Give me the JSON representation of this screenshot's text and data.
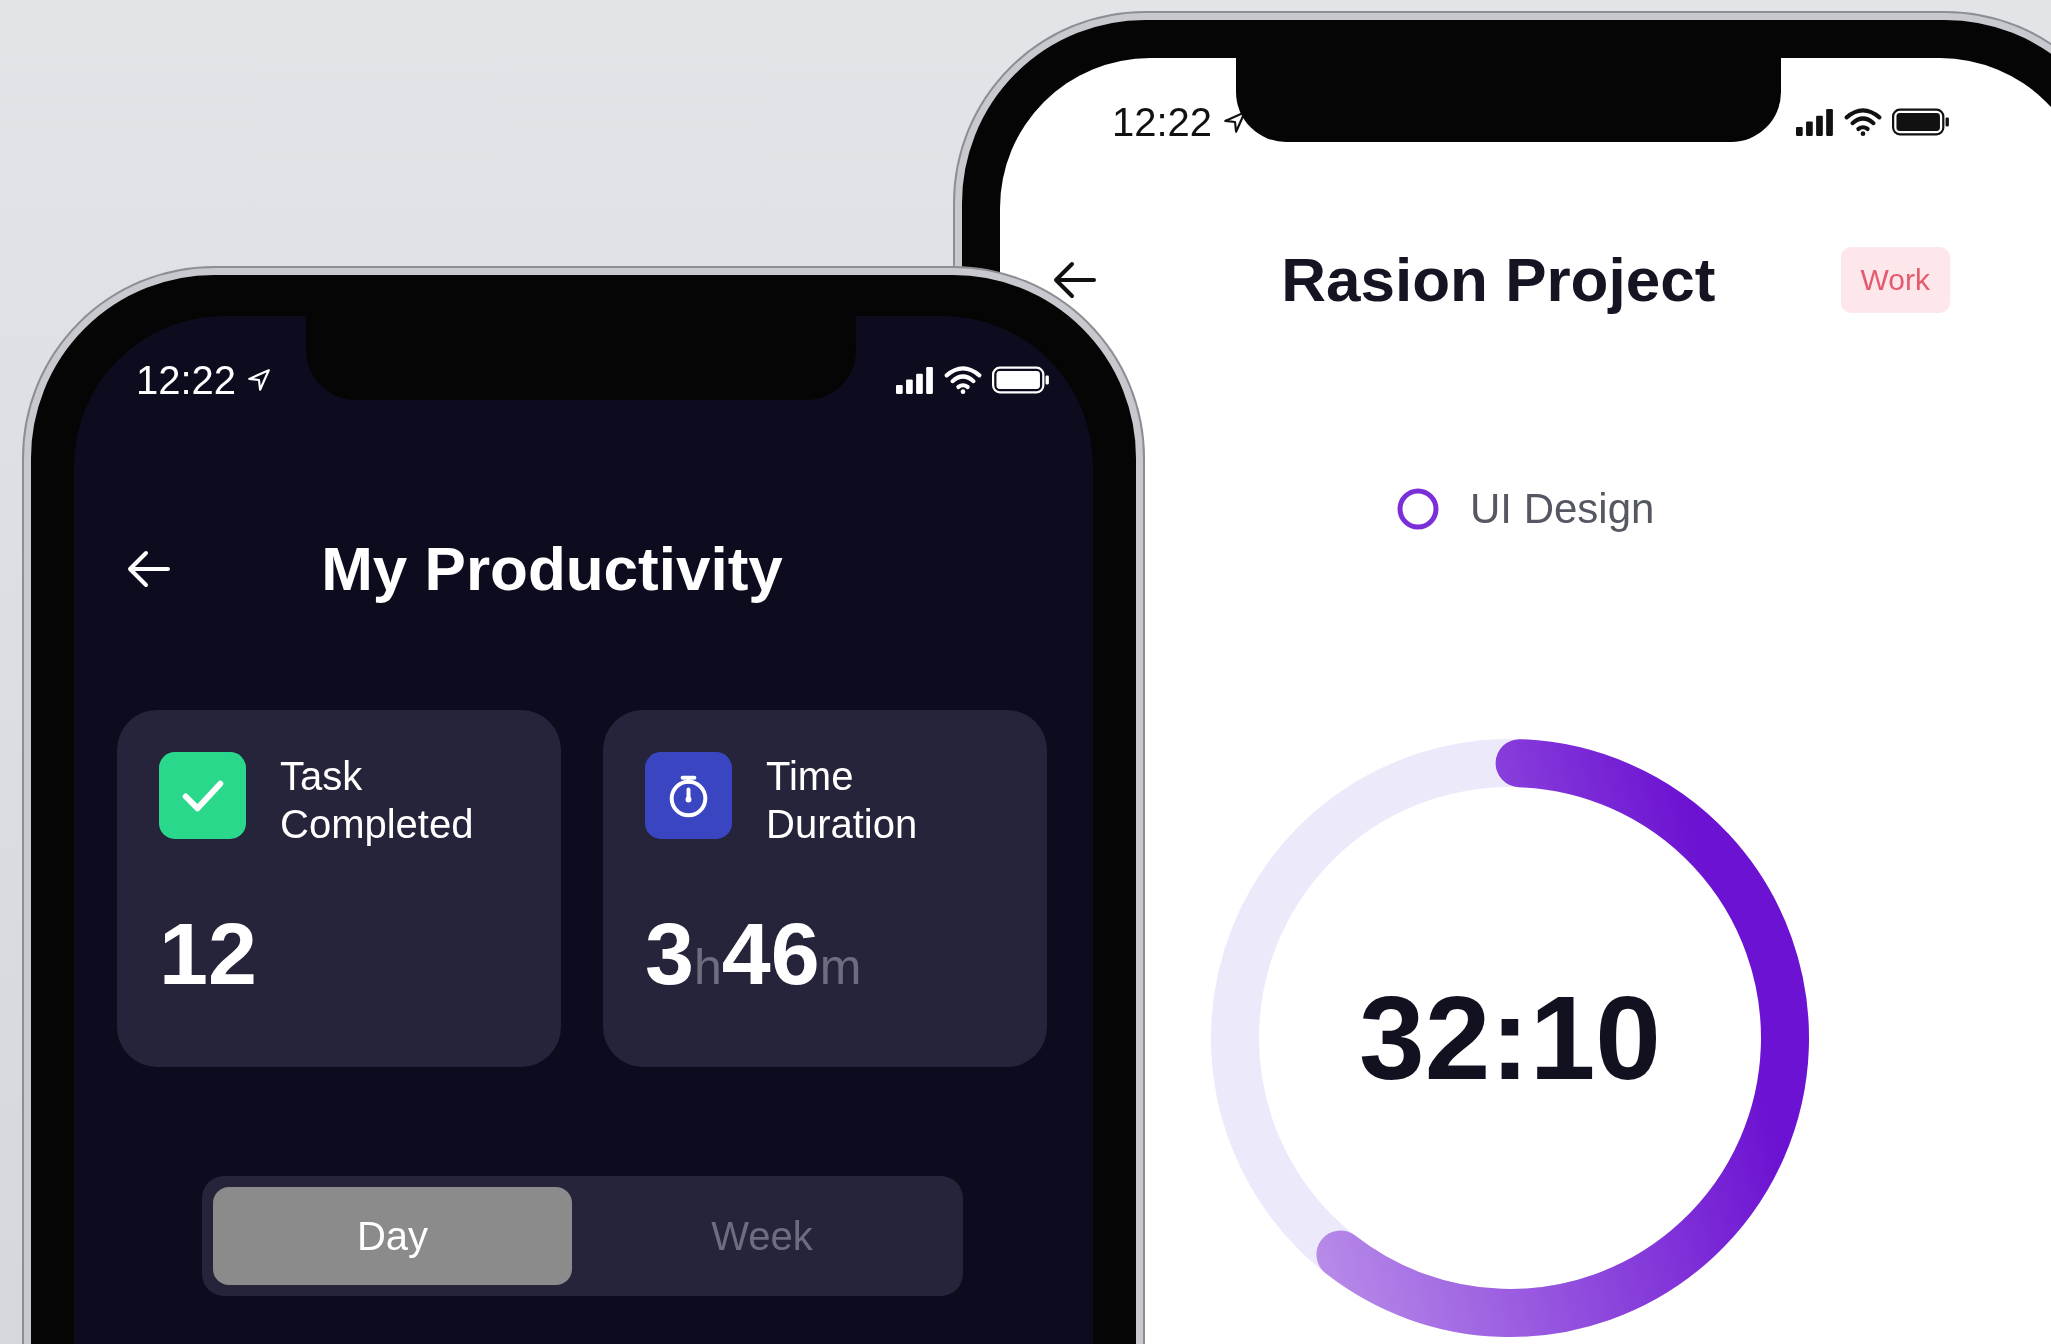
{
  "back_phone": {
    "status_bar": {
      "time": "12:22"
    },
    "title": "Rasion Project",
    "tag": "Work",
    "task": "UI Design",
    "timer": {
      "reading": "32:10",
      "level": 0.6
    }
  },
  "front_phone": {
    "status_bar": {
      "time": "12:22"
    },
    "title": "My Productivity",
    "stats": [
      {
        "kind": "tasks",
        "label": "Task Completed",
        "value": [
          {
            "number": "12"
          }
        ]
      },
      {
        "kind": "duration",
        "label": "Time Duration",
        "value": [
          {
            "number": "3",
            "unit": "h"
          },
          {
            "number": "46",
            "unit": "m"
          }
        ]
      }
    ],
    "tabs": [
      {
        "label": "Day",
        "selected": true
      },
      {
        "label": "Week",
        "selected": false
      }
    ]
  }
}
